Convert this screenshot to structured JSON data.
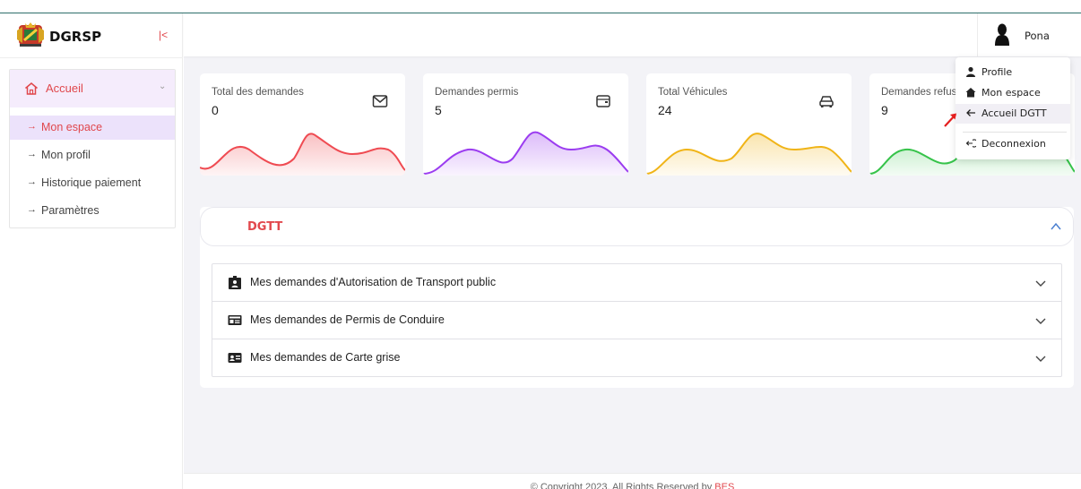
{
  "brand": {
    "name": "DGRSP",
    "collapse_icon": "collapse-left-icon"
  },
  "sidebar": {
    "group": {
      "label": "Accueil",
      "icon": "home-icon"
    },
    "items": [
      {
        "label": "Mon espace",
        "active": true
      },
      {
        "label": "Mon profil",
        "active": false
      },
      {
        "label": "Historique paiement",
        "active": false
      },
      {
        "label": "Paramètres",
        "active": false
      }
    ]
  },
  "header": {
    "user_name": "Pona"
  },
  "stats": [
    {
      "title": "Total des demandes",
      "value": "0",
      "icon": "mail-icon",
      "color": "#ef4b52"
    },
    {
      "title": "Demandes permis",
      "value": "5",
      "icon": "wallet-icon",
      "color": "#9b3cf0"
    },
    {
      "title": "Total Véhicules",
      "value": "24",
      "icon": "car-icon",
      "color": "#f0b417"
    },
    {
      "title": "Demandes refusées",
      "value": "9",
      "icon": "close-icon",
      "color": "#36c34a"
    }
  ],
  "panel": {
    "title": "DGTT",
    "items": [
      {
        "label": "Mes demandes d'Autorisation de Transport public",
        "icon": "badge-icon"
      },
      {
        "label": "Mes demandes de Permis de Conduire",
        "icon": "id-card-icon"
      },
      {
        "label": "Mes demandes de Carte grise",
        "icon": "contact-card-icon"
      }
    ]
  },
  "dropdown": {
    "items": [
      {
        "label": "Profile",
        "icon": "user-icon"
      },
      {
        "label": "Mon espace",
        "icon": "house-icon"
      },
      {
        "label": "Accueil DGTT",
        "icon": "arrow-left-icon"
      },
      {
        "label": "Deconnexion",
        "icon": "logout-icon"
      }
    ]
  },
  "footer": {
    "text": "© Copyright 2023. All Rights Reserved by ",
    "brand": "BES"
  },
  "colors": {
    "accent": "#e2484d",
    "active_bg": "#ece2fb"
  }
}
